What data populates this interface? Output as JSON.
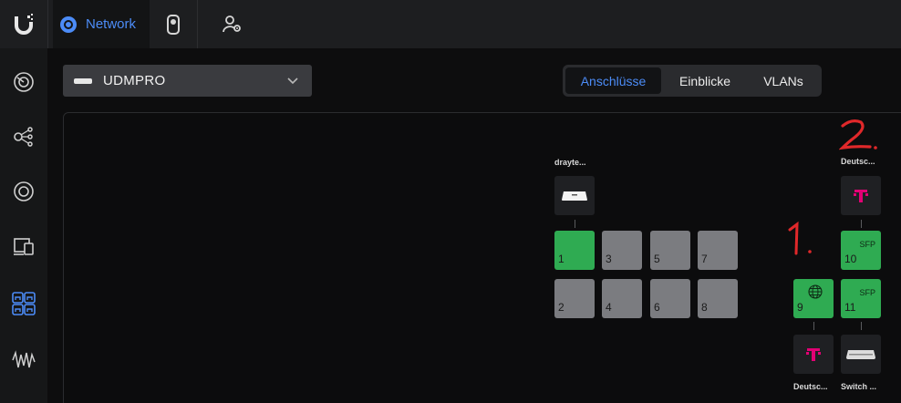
{
  "topbar": {
    "logo": "ubiquiti-logo-icon",
    "tabs": [
      {
        "label": "Network",
        "icon": "network-icon"
      },
      {
        "label": "",
        "icon": "protect-camera-icon"
      },
      {
        "label": "",
        "icon": "user-settings-icon"
      }
    ]
  },
  "sidebar": {
    "items": [
      "dashboard-icon",
      "topology-icon",
      "client-devices-icon",
      "unifi-devices-icon",
      "ports-icon",
      "traffic-icon"
    ],
    "active_index": 4
  },
  "device_selector": {
    "name": "UDMPRO"
  },
  "view_tabs": {
    "items": [
      "Anschlüsse",
      "Einblicke",
      "VLANs"
    ],
    "active": "Anschlüsse"
  },
  "topology": {
    "draytek_label": "drayte...",
    "deutsche_top_label": "Deutsc...",
    "deutsche_bottom_label": "Deutsc...",
    "switch_label": "Switch ...",
    "ports": [
      {
        "num": "1",
        "status": "up"
      },
      {
        "num": "2",
        "status": "down"
      },
      {
        "num": "3",
        "status": "down"
      },
      {
        "num": "4",
        "status": "down"
      },
      {
        "num": "5",
        "status": "down"
      },
      {
        "num": "6",
        "status": "down"
      },
      {
        "num": "7",
        "status": "down"
      },
      {
        "num": "8",
        "status": "down"
      },
      {
        "num": "9",
        "status": "up",
        "type": "wan"
      },
      {
        "num": "10",
        "status": "up",
        "type": "SFP"
      },
      {
        "num": "11",
        "status": "up",
        "type": "SFP"
      }
    ],
    "annotations": [
      "1.",
      "2."
    ]
  },
  "colors": {
    "accent": "#4c8cf7",
    "port_up": "#2fab52",
    "port_down": "#7b7c80",
    "telekom": "#e20074",
    "annotation": "#e0282a"
  }
}
